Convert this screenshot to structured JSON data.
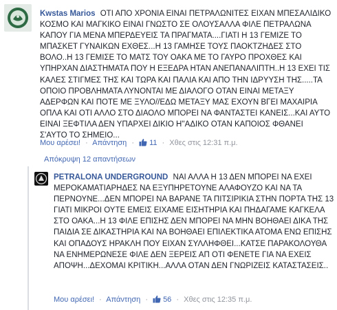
{
  "comment1": {
    "author": "Kwstas Marios",
    "text": "ΟΤΙ ΑΠΟ ΧΡΟΝΙΑ ΕΙΝΑΙ ΠΕΤΡΑΛΩΝΙΤΕΣ ΕΙΧΑΝ ΜΠΕΣΑΛΙΔΙΚΟ ΚΟΣΜΟ ΚΑΙ ΜΑΓΚΙΚΟ ΕΙΝΑΙ ΓΝΩΣΤΟ ΣΕ ΟΛΟΥΣΑΛΛΑ ΦΙΛΕ ΠΕΤΡΑΛΩΝΑ ΚΑΠΟΥ ΓΙΑ ΜΕΝΑ ΜΠΕΡΔΕΥΕΙΣ ΤΑ ΠΡΑΓΜΑΤΑ....ΓΙΑΤΙ Η 13 ΓΕΜΙΖΕ ΤΟ ΜΠΑΣΚΕΤ ΓΥΝΑΙΚΩΝ ΕΧΘΕΣ...Η 13 ΓΑΜΗΣΕ ΤΟΥΣ ΠΑΟΚΤΖΗΔΕΣ ΣΤΟ ΒΟΛΟ..Η 13 ΓΕΜΙΣΕ ΤΟ ΜΑΤΣ ΤΟΥ ΟΑΚΑ ΜΕ ΤΟ ΓΑΥΡΟ ΠΡΟΧΘΕΣ ΚΑΙ ΥΠΗΡΧΑΝ ΔΙΑΣΤΗΜΑΤΑ ΠΟΥ Η ΕΞΕΔΡΑ ΗΤΑΝ ΑΝΕΠΑΝΑΛΙΠΤΗ..Η 13 ΕΧΕΙ ΤΙΣ ΚΑΛΕΣ ΣΤΙΓΜΕΣ ΤΗΣ ΚΑΙ ΤΩΡΑ ΚΑΙ ΠΑΛΙΑ ΚΑΙ ΑΠΟ ΤΗΝ ΙΔΡΥΥΣΗ ΤΗΣ.....ΤΑ ΟΠΟΙΟ ΠΡΟΒΛΗΜΑΤΑ ΛΥΝΟΝΤΑΙ ΜΕ ΔΙΑΛΟΓΟ ΟΤΑΝ ΕΙΝΑΙ ΜΕΤΑΞΥ ΑΔΕΡΦΩΝ ΚΑΙ ΠΟΤΕ ΜΕ ΞΥΛΟ//ΕΔΩ ΜΕΤΑΞΥ ΜΑΣ ΕΧΟΥΝ ΒΓΕΙ ΜΑΧΑΙΡΙΑ ΟΠΛΑ ΚΑΙ ΟΤΙ ΑΛΛΟ ΣΤΟ ΔΙΑΟΛΟ ΜΠΟΡΕΙ ΝΑ ΦΑΝΤΑΣΤΕΙ ΚΑΝΕΙΣ...ΚΑΙ ΑΥΤΟ ΕΙΝΑΙ ΞΕΦΤΙΛΑ ΔΕΝ ΥΠΑΡΧΕΙ ΔΙΚΙΟ Η''ΑΔΙΚΟ ΟΤΑΝ ΚΑΠΟΙΟΣ ΦΘΑΝΕΙ Σ'ΑΥΤΟ ΤΟ ΣΗΜΕΙΟ...",
    "like_label": "Μου αρέσει!",
    "reply_label": "Απάντηση",
    "likes": "11",
    "time": "Χθες στις 12:31 π.μ."
  },
  "hide_replies_label": "Απόκρυψη 12 απαντήσεων",
  "comment2": {
    "author": "PETRALONA UNDERGROUND",
    "text": "ΝΑΙ ΑΛΛΑ Η 13 ΔΕΝ ΜΠΟΡΕΙ ΝΑ ΕΧΕΙ ΜΕΡΟΚΑΜΑΤΙΑΡΗΔΕΣ ΝΑ ΕΞΥΠΗΡΕΤΟΥΝΕ ΑΛΑΦΟΥΖΟ ΚΑΙ ΝΑ ΤΑ ΠΕΡΝΟΥΝΕ...ΔΕΝ ΜΠΟΡΕΙ ΝΑ ΒΑΡΑΝΕ ΤΑ ΠΙΤΣΙΡΙΚΙΑ ΣΤΗΝ ΠΟΡΤΑ ΤΗΣ 13 ΓΙΑΤΙ ΜΙΚΡΟΙ ΟΥΤΕ ΕΜΕΙΣ ΕΙΧΑΜΕ ΕΙΣΗΤΗΡΙΑ ΚΑΙ ΠΗΔΑΓΑΜΕ ΚΑΓΚΕΛΑ ΣΤΟ ΟΑΚΑ...Η 13 ΦΙΛΕ ΕΠΙΣΗΣ ΔΕΝ ΜΠΟΡΕΙ ΝΑ ΜΗΝ ΒΟΗΘΑΕΙ ΔΙΚΑ ΤΗΣ ΠΑΙΔΙΑ ΣΕ ΔΙΚΑΣΤΗΡΙΑ ΚΑΙ ΝΑ ΒΟΗΘΑΕΙ ΕΠΙΛΕΚΤΙΚΑ ΑΤΟΜΑ ΕΝΩ ΕΠΙΣΗΣ ΚΑΙ ΟΠΑΔΟΥΣ ΗΡΑΚΛΗ ΠΟΥ ΕΙΧΑΝ ΣΥΛΛΗΦΘΕΙ...ΚΑΤΣΕ ΠΑΡΑΚΟΛΟΥΘΑ ΝΑ ΕΝΗΜΕΡΩΝΕΣΕ ΦΙΛΕ ΔΕΝ ΞΕΡΕΙΣ ΑΠ ΟΤΙ ΦΕΝΕΤΕ ΓΙΑ ΝΑ ΕΧΕΙΣ ΑΠΟΨΗ...ΔΕΧΟΜΑΙ ΚΡΙΤΙΚΗ...ΑΛΛΑ ΟΤΑΝ ΔΕΝ ΓΝΩΡΙΖΕΙΣ ΚΑΤΑΣΤΑΣΕΙΣ..",
    "like_label": "Μου αρέσει!",
    "reply_label": "Απάντηση",
    "likes": "56",
    "time": "Χθες στις 12:35 π.μ."
  },
  "icons": {
    "avatar1": "green-emblem-avatar",
    "avatar2": "petralona-logo-avatar",
    "like": "thumbs-up-icon"
  },
  "colors": {
    "link": "#365899",
    "meta": "#90949c",
    "action": "#4267b2"
  }
}
